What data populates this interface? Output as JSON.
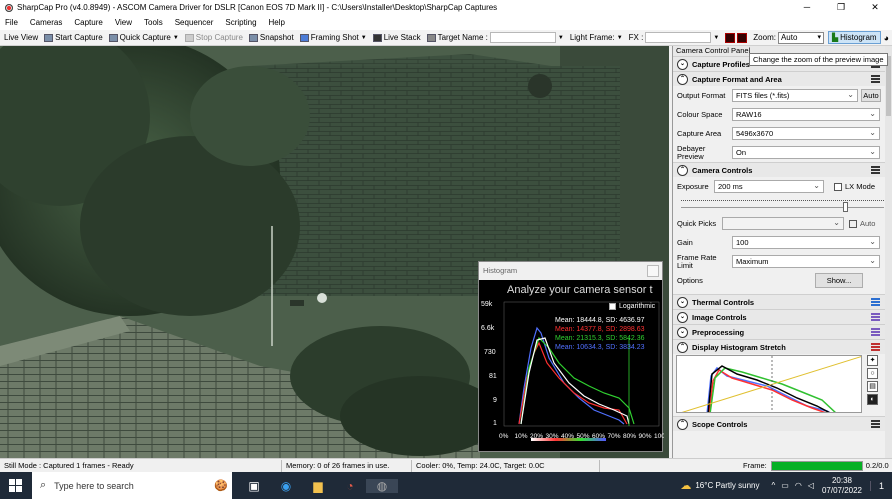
{
  "window": {
    "title": "SharpCap Pro (v4.0.8949) - ASCOM Camera Driver for DSLR [Canon EOS 7D Mark II] - C:\\Users\\Installer\\Desktop\\SharpCap Captures",
    "min": "─",
    "max": "❐",
    "close": "✕"
  },
  "menu": [
    "File",
    "Cameras",
    "Capture",
    "View",
    "Tools",
    "Sequencer",
    "Scripting",
    "Help"
  ],
  "toolbar": {
    "live_view": "Live View",
    "start_capture": "Start Capture",
    "quick_capture": "Quick Capture",
    "stop_capture": "Stop Capture",
    "snapshot": "Snapshot",
    "framing_shot": "Framing Shot",
    "live_stack": "Live Stack",
    "target_name": "Target Name :",
    "light_frames": "Light Frame:",
    "fx": "FX :",
    "zoom_label": "Zoom:",
    "zoom_value": "Auto",
    "histogram": "Histogram"
  },
  "tooltip": "Change the zoom of the preview image",
  "histogram": {
    "title": "Histogram",
    "banner": "Analyze your camera sensor t",
    "logarithmic": "Logarithmic",
    "y_ticks": [
      "59k",
      "6.6k",
      "730",
      "81",
      "9",
      "1"
    ],
    "x_ticks": [
      "0%",
      "10%",
      "20%",
      "30%",
      "40%",
      "50%",
      "60%",
      "70%",
      "80%",
      "90%",
      "100%"
    ],
    "stats": [
      {
        "text": "Mean: 18444.8, SD: 4636.97",
        "color": "#ffffff"
      },
      {
        "text": "Mean: 14377.8, SD: 2898.63",
        "color": "#ff3030"
      },
      {
        "text": "Mean: 21315.3, SD: 5842.36",
        "color": "#30d030"
      },
      {
        "text": "Mean: 10634.3, SD: 3834.23",
        "color": "#5070ff"
      }
    ]
  },
  "panel": {
    "title": "Camera Control Panel",
    "sections": {
      "capture_profiles": "Capture Profiles",
      "capture_format": "Capture Format and Area",
      "camera_controls": "Camera Controls",
      "thermal": "Thermal Controls",
      "image": "Image Controls",
      "preprocessing": "Preprocessing",
      "display_hist": "Display Histogram Stretch",
      "scope": "Scope Controls"
    },
    "output_format_label": "Output Format",
    "output_format": "FITS files (*.fits)",
    "auto_btn": "Auto",
    "colour_space_label": "Colour Space",
    "colour_space": "RAW16",
    "capture_area_label": "Capture Area",
    "capture_area": "5496x3670",
    "debayer_label": "Debayer Preview",
    "debayer": "On",
    "exposure_label": "Exposure",
    "exposure": "200 ms",
    "lx_mode": "LX Mode",
    "quick_picks_label": "Quick Picks",
    "auto_check": "Auto",
    "gain_label": "Gain",
    "gain": "100",
    "frame_rate_label": "Frame Rate Limit",
    "frame_rate": "Maximum",
    "options_label": "Options",
    "show_btn": "Show...",
    "exposure_slider": 0.82
  },
  "status": {
    "mode": "Still Mode : Captured 1 frames - Ready",
    "memory": "Memory: 0 of 26 frames in use.",
    "cooler": "Cooler: 0%, Temp: 24.0C, Target: 0.0C",
    "frame_label": "Frame:",
    "frame_value": "0.2/0.0"
  },
  "taskbar": {
    "search": "Type here to search",
    "weather": "16°C  Partly sunny",
    "time": "20:38",
    "date": "07/07/2022",
    "notif": "1"
  },
  "colors": {
    "accent": "#0078d7",
    "frame_progress": "#06b025",
    "hist_blue": "#2b6fd1"
  }
}
